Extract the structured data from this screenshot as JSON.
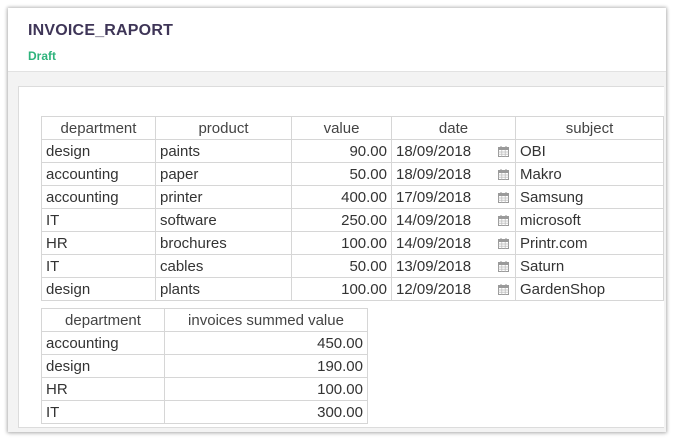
{
  "header": {
    "title": "INVOICE_RAPORT",
    "status": "Draft"
  },
  "invoices": {
    "columns": [
      "department",
      "product",
      "value",
      "date",
      "subject"
    ],
    "rows": [
      {
        "department": "design",
        "product": "paints",
        "value": "90.00",
        "date": "18/09/2018",
        "subject": "OBI"
      },
      {
        "department": "accounting",
        "product": "paper",
        "value": "50.00",
        "date": "18/09/2018",
        "subject": "Makro"
      },
      {
        "department": "accounting",
        "product": "printer",
        "value": "400.00",
        "date": "17/09/2018",
        "subject": "Samsung"
      },
      {
        "department": "IT",
        "product": "software",
        "value": "250.00",
        "date": "14/09/2018",
        "subject": "microsoft"
      },
      {
        "department": "HR",
        "product": "brochures",
        "value": "100.00",
        "date": "14/09/2018",
        "subject": "Printr.com"
      },
      {
        "department": "IT",
        "product": "cables",
        "value": "50.00",
        "date": "13/09/2018",
        "subject": "Saturn"
      },
      {
        "department": "design",
        "product": "plants",
        "value": "100.00",
        "date": "12/09/2018",
        "subject": "GardenShop"
      }
    ],
    "date_icon": "calendar-icon"
  },
  "summary": {
    "columns": [
      "department",
      "invoices summed value"
    ],
    "rows": [
      {
        "department": "accounting",
        "sum": "450.00"
      },
      {
        "department": "design",
        "sum": "190.00"
      },
      {
        "department": "HR",
        "sum": "100.00"
      },
      {
        "department": "IT",
        "sum": "300.00"
      }
    ]
  },
  "colors": {
    "title": "#3e3557",
    "status": "#2eb37c",
    "border": "#d6d6d6",
    "background": "#f3f3f3"
  }
}
